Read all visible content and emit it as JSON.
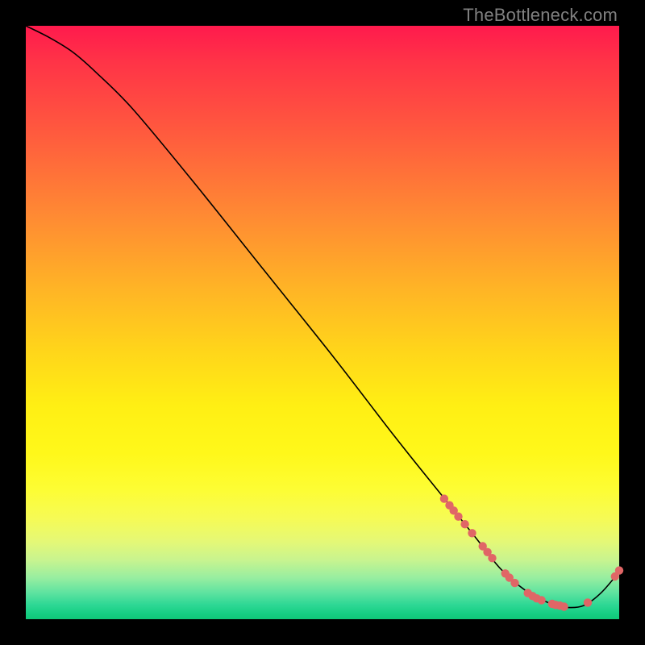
{
  "watermark": "TheBottleneck.com",
  "colors": {
    "dot": "#e06666",
    "curve": "#000000",
    "background": "#000000"
  },
  "chart_data": {
    "type": "line",
    "title": "",
    "xlabel": "",
    "ylabel": "",
    "xlim": [
      0,
      100
    ],
    "ylim": [
      0,
      100
    ],
    "grid": false,
    "legend": false,
    "series": [
      {
        "name": "bottleneck-curve",
        "x": [
          0,
          4,
          8,
          12,
          18,
          28,
          40,
          52,
          62,
          70,
          76,
          80,
          84,
          88,
          91,
          94,
          97,
          100
        ],
        "y": [
          100,
          98,
          95.5,
          92,
          86,
          74,
          59,
          44,
          31,
          21,
          13.5,
          8.5,
          5,
          2.8,
          2,
          2.3,
          4.5,
          8
        ]
      }
    ],
    "points": [
      {
        "name": "cluster-upper-slope",
        "x": 70.5,
        "y": 20.3
      },
      {
        "name": "cluster-upper-slope",
        "x": 71.4,
        "y": 19.2
      },
      {
        "name": "cluster-upper-slope",
        "x": 72.1,
        "y": 18.3
      },
      {
        "name": "cluster-upper-slope",
        "x": 72.9,
        "y": 17.3
      },
      {
        "name": "cluster-upper-slope",
        "x": 74.0,
        "y": 16.0
      },
      {
        "name": "cluster-upper-slope",
        "x": 75.2,
        "y": 14.5
      },
      {
        "name": "cluster-mid-slope",
        "x": 77.0,
        "y": 12.3
      },
      {
        "name": "cluster-mid-slope",
        "x": 77.8,
        "y": 11.3
      },
      {
        "name": "cluster-mid-slope",
        "x": 78.6,
        "y": 10.3
      },
      {
        "name": "cluster-lower-slope",
        "x": 80.8,
        "y": 7.7
      },
      {
        "name": "cluster-lower-slope",
        "x": 81.5,
        "y": 7.0
      },
      {
        "name": "cluster-lower-slope",
        "x": 82.4,
        "y": 6.1
      },
      {
        "name": "valley-floor",
        "x": 84.6,
        "y": 4.4
      },
      {
        "name": "valley-floor",
        "x": 85.4,
        "y": 3.9
      },
      {
        "name": "valley-floor",
        "x": 86.1,
        "y": 3.5
      },
      {
        "name": "valley-floor",
        "x": 86.9,
        "y": 3.2
      },
      {
        "name": "valley-floor",
        "x": 88.7,
        "y": 2.6
      },
      {
        "name": "valley-floor",
        "x": 89.3,
        "y": 2.4
      },
      {
        "name": "valley-floor",
        "x": 90.0,
        "y": 2.3
      },
      {
        "name": "valley-floor",
        "x": 90.7,
        "y": 2.1
      },
      {
        "name": "valley-right",
        "x": 94.7,
        "y": 2.8
      },
      {
        "name": "rising-tail",
        "x": 99.3,
        "y": 7.2
      },
      {
        "name": "rising-tail",
        "x": 100.0,
        "y": 8.2
      }
    ]
  }
}
